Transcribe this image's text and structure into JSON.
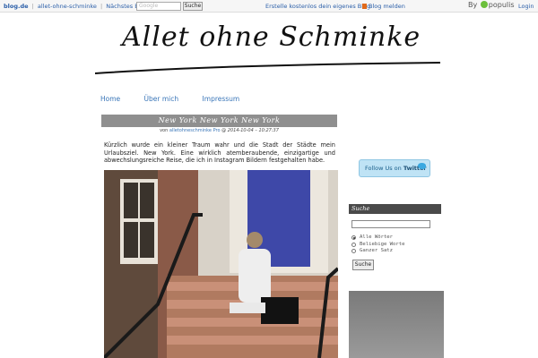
{
  "topbar": {
    "brand": "blog.de",
    "blog_name": "allet-ohne-schminke",
    "next_blog": "Nächstes Blog »",
    "search_placeholder": "Google",
    "search_button": "Suche",
    "create_blog": "Erstelle kostenlos dein eigenes Blog",
    "report_blog": "Blog melden",
    "by_label": "By",
    "populis": "populis",
    "login": "Login",
    "colors": {
      "link": "#2a5ea8",
      "flag": "#e06a1b",
      "populis_dot": "#6bbf3b"
    }
  },
  "header": {
    "title": "Allet ohne Schminke"
  },
  "nav": {
    "items": [
      "Home",
      "Über mich",
      "Impressum"
    ]
  },
  "post": {
    "title": "New York New York New York",
    "meta_prefix": "von",
    "author": "alletohneschminke",
    "author_badge": "Pro",
    "date_prefix": "@",
    "date": "2014-10-04 – 10:27:37",
    "body": "Kürzlich wurde ein kleiner Traum wahr und die Stadt der Städte mein Urlaubsziel. New York. Eine wirklich atemberaubende, einzigartige und abwechslungsreiche Reise, die ich in Instagram Bildern festgehalten habe."
  },
  "sidebar": {
    "twitter_text": "Follow Us on",
    "twitter_brand": "Twitter",
    "search_heading": "Suche",
    "search_options": [
      "Alle Wörter",
      "Beliebige Worte",
      "Ganzer Satz"
    ],
    "search_button": "Suche"
  }
}
